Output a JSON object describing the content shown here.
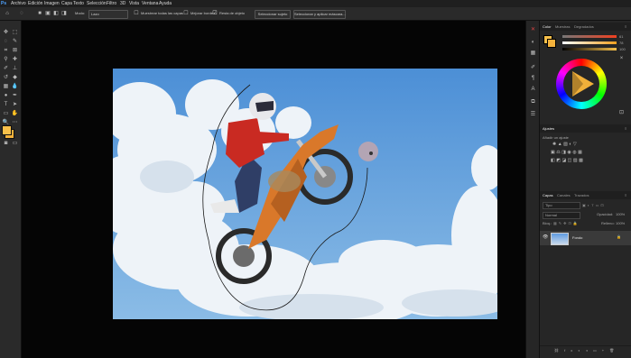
{
  "menu": {
    "items": [
      "Archivo",
      "Edición",
      "Imagen",
      "Capa",
      "Texto",
      "Selección",
      "Filtro",
      "3D",
      "Vista",
      "Ventana",
      "Ayuda"
    ]
  },
  "options_bar": {
    "size_label": "Modo:",
    "size_value": "Lazo",
    "sample_all_layers": "Muestrear todas las capas",
    "improve_edge": "Mejorar borde",
    "object_subtract": "Resta de objeto",
    "select_subject": "Seleccionar sujeto",
    "select_and_mask": "Seleccionar y aplicar máscara..."
  },
  "colors": {
    "foreground": "#f7c04a",
    "background": "#f4b23c",
    "accent": "#cf3a2a"
  },
  "color_panel": {
    "tabs": [
      "Color",
      "Muestras",
      "Degradados"
    ],
    "active_tab": "Color",
    "values": [
      "61",
      "78",
      "100"
    ]
  },
  "adjustments_panel": {
    "title": "Ajustes",
    "subtitle": "Añadir un ajuste"
  },
  "layers_panel": {
    "tabs": [
      "Capas",
      "Canales",
      "Trazados"
    ],
    "active_tab": "Capas",
    "search_placeholder": "Tipo",
    "blend_mode": "Normal",
    "opacity_label": "Opacidad:",
    "opacity_value": "100%",
    "lock_label": "Bloq.:",
    "fill_label": "Relleno:",
    "fill_value": "100%",
    "layer_name": "Fondo"
  },
  "toolbar_icons": [
    "move-icon",
    "marquee-icon",
    "lasso-icon",
    "quick-select-icon",
    "crop-icon",
    "eyedropper-icon",
    "healing-icon",
    "brush-icon",
    "clone-icon",
    "history-brush-icon",
    "eraser-icon",
    "gradient-icon",
    "blur-icon",
    "dodge-icon",
    "pen-icon",
    "type-icon",
    "path-select-icon",
    "shape-icon",
    "hand-icon",
    "zoom-icon",
    "more-icon"
  ]
}
